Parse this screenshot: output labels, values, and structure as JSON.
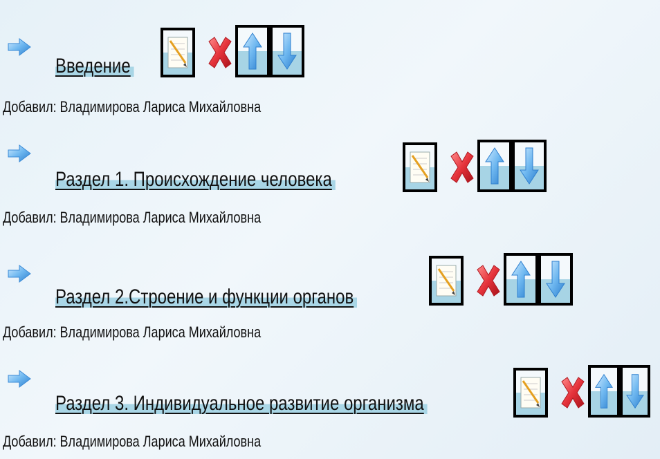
{
  "entries": [
    {
      "title": "Введение",
      "author_label": "Добавил:",
      "author_name": "Владимирова Лариса Михайловна"
    },
    {
      "title": "Раздел 1. Происхождение человека",
      "author_label": "Добавил:",
      "author_name": "Владимирова Лариса Михайловна"
    },
    {
      "title": "Раздел 2.Строение и функции органов",
      "author_label": "Добавил:",
      "author_name": "Владимирова Лариса Михайловна"
    },
    {
      "title": "Раздел 3. Индивидуальное развитие организма",
      "author_label": "Добавил:",
      "author_name": "Владимирова Лариса Михайловна"
    }
  ],
  "icons": {
    "bullet": "right-arrow-icon",
    "edit": "edit-note-icon",
    "delete": "delete-x-icon",
    "move_up": "up-arrow-icon",
    "move_down": "down-arrow-icon"
  },
  "colors": {
    "highlight": "#a9d6e6",
    "arrow_blue": "#4fa3e0",
    "delete_red": "#e0303a"
  }
}
